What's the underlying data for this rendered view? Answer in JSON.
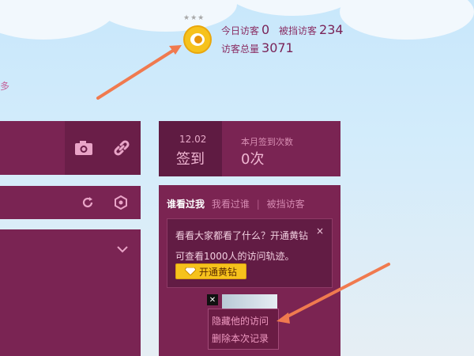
{
  "visitors_widget": {
    "today_label": "今日访客",
    "today_value": "0",
    "blocked_label": "被挡访客",
    "blocked_value": "234",
    "total_label": "访客总量",
    "total_value": "3071",
    "stars": "★★★"
  },
  "side_text": "多",
  "checkin": {
    "date": "12.02",
    "sign_label": "签到",
    "count_label": "本月签到次数",
    "count_value": "0次"
  },
  "visitors_panel": {
    "tabs": [
      "谁看过我",
      "我看过谁",
      "被挡访客"
    ],
    "separator": "|",
    "notice_line1": "看看大家都看了什么？开通黄钻",
    "notice_line2": "可查看1000人的访问轨迹。",
    "notice_close": "×",
    "upgrade_button": "开通黄钻",
    "thumb_close": "✕",
    "menu_items": [
      "隐藏他的访问",
      "删除本次记录"
    ]
  },
  "colors": {
    "panel": "#7a2453",
    "panel_dark": "#5e1a40",
    "accent": "#f6c21c",
    "arrow": "#f07a4f"
  }
}
